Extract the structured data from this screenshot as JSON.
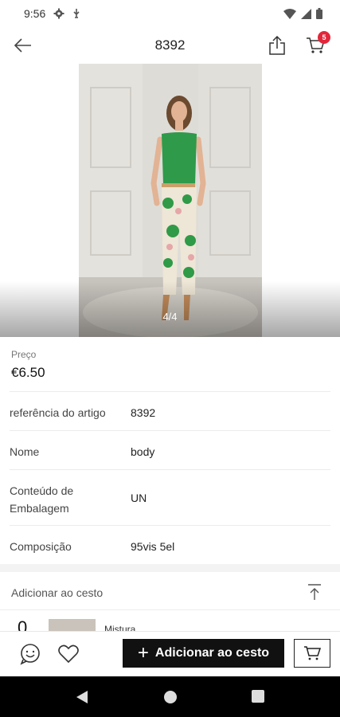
{
  "status_bar": {
    "time": "9:56"
  },
  "app_bar": {
    "title": "8392",
    "cart_count": "5"
  },
  "gallery": {
    "counter": "4/4"
  },
  "price": {
    "label": "Preço",
    "value": "€6.50"
  },
  "details": [
    {
      "key": "referência do artigo",
      "value": "8392"
    },
    {
      "key": "Nome",
      "value": "body"
    },
    {
      "key": "Conteúdo de Embalagem",
      "value": "UN"
    },
    {
      "key": "Composição",
      "value": "95vis 5el"
    }
  ],
  "add_to_cart_section": {
    "label": "Adicionar ao cesto"
  },
  "variant": {
    "quantity": "0",
    "name": "Mistura"
  },
  "action_bar": {
    "add_label": "Adicionar ao cesto"
  },
  "colors": {
    "badge": "#e3263a",
    "button": "#111111",
    "top_green": "#2e9a4a"
  }
}
